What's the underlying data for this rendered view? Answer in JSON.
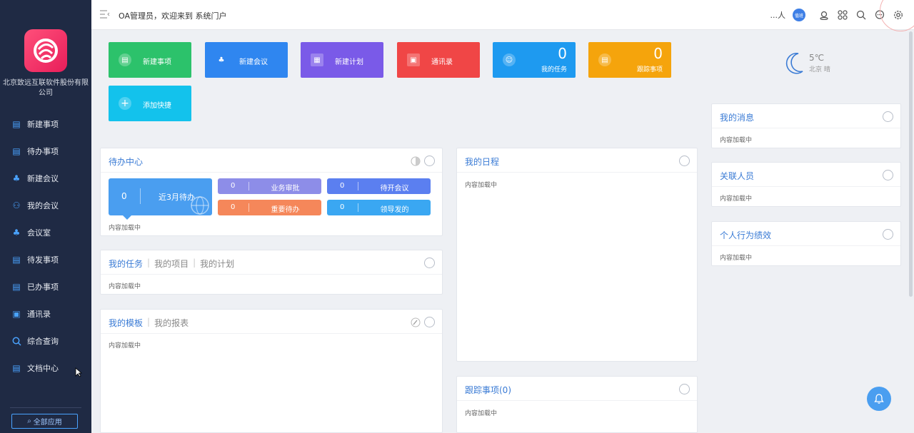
{
  "sidebar": {
    "company": "北京致远互联软件股份有限公司",
    "items": [
      {
        "label": "新建事项",
        "icon": "new-item-icon"
      },
      {
        "label": "待办事项",
        "icon": "todo-icon"
      },
      {
        "label": "新建会议",
        "icon": "meeting-icon"
      },
      {
        "label": "我的会议",
        "icon": "my-meeting-icon"
      },
      {
        "label": "会议室",
        "icon": "meeting-room-icon"
      },
      {
        "label": "待发事项",
        "icon": "pending-send-icon"
      },
      {
        "label": "已办事项",
        "icon": "done-icon"
      },
      {
        "label": "通讯录",
        "icon": "contacts-icon"
      },
      {
        "label": "综合查询",
        "icon": "search-icon"
      },
      {
        "label": "文档中心",
        "icon": "document-icon"
      }
    ],
    "all_apps": "全部应用"
  },
  "header": {
    "welcome": "OA管理员，欢迎来到 系统门户",
    "user": "...人",
    "user_badge": "值班"
  },
  "tiles": [
    {
      "label": "新建事项",
      "color": "#2cc26b"
    },
    {
      "label": "新建会议",
      "color": "#2f86f0"
    },
    {
      "label": "新建计划",
      "color": "#7a5ae8"
    },
    {
      "label": "通讯录",
      "color": "#f04646"
    },
    {
      "count": "0",
      "label": "我的任务",
      "color": "#1e9af0"
    },
    {
      "count": "0",
      "label": "跟踪事项",
      "color": "#f5a40c"
    },
    {
      "label": "添加快捷",
      "color": "#13c2ec"
    }
  ],
  "weather": {
    "temp": "5℃",
    "city": "北京 晴"
  },
  "todo_center": {
    "title": "待办中心",
    "big": {
      "count": "0",
      "label": "近3月待办"
    },
    "chips": [
      {
        "count": "0",
        "label": "业务审批",
        "color": "#8d8de8"
      },
      {
        "count": "0",
        "label": "待开会议",
        "color": "#5b7ff0"
      },
      {
        "count": "0",
        "label": "重要待办",
        "color": "#f5875a"
      },
      {
        "count": "0",
        "label": "领导发的",
        "color": "#3aa7f2"
      }
    ],
    "loading": "内容加载中"
  },
  "tasks_panel": {
    "tabs": [
      "我的任务",
      "我的项目",
      "我的计划"
    ],
    "loading": "内容加载中"
  },
  "templates_panel": {
    "tabs": [
      "我的模板",
      "我的报表"
    ],
    "loading": "内容加载中"
  },
  "schedule_panel": {
    "title": "我的日程",
    "loading": "内容加载中"
  },
  "tracking_panel": {
    "title": "跟踪事项(0)",
    "loading": "内容加载中"
  },
  "messages_panel": {
    "title": "我的消息",
    "loading": "内容加载中"
  },
  "related_panel": {
    "title": "关联人员",
    "loading": "内容加载中"
  },
  "performance_panel": {
    "title": "个人行为绩效",
    "loading": "内容加载中"
  }
}
